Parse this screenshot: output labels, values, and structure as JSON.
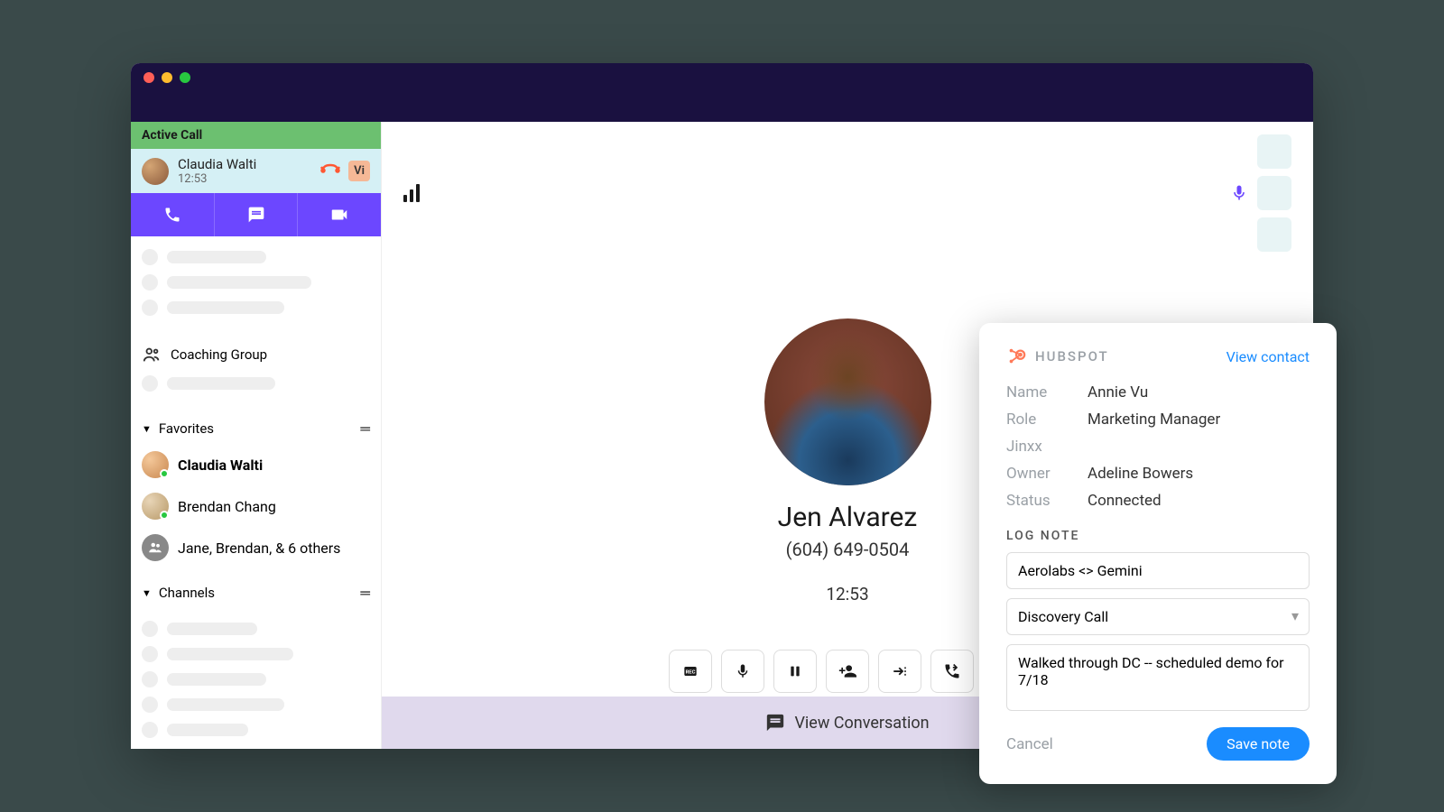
{
  "sidebar": {
    "active_call_label": "Active Call",
    "call": {
      "name": "Claudia Walti",
      "duration": "12:53",
      "badge": "Vi"
    },
    "coaching_label": "Coaching Group",
    "favorites_label": "Favorites",
    "favorites": [
      {
        "name": "Claudia Walti",
        "bold": true
      },
      {
        "name": "Brendan Chang",
        "bold": false
      },
      {
        "name": "Jane, Brendan, & 6 others",
        "group": true
      }
    ],
    "channels_label": "Channels"
  },
  "call_screen": {
    "name": "Jen Alvarez",
    "phone": "(604) 649-0504",
    "timer": "12:53",
    "view_conversation": "View Conversation"
  },
  "crm": {
    "brand": "HUBSPOT",
    "view_contact": "View contact",
    "fields": {
      "name_label": "Name",
      "name_value": "Annie Vu",
      "role_label": "Role",
      "role_value": "Marketing Manager",
      "company": "Jinxx",
      "owner_label": "Owner",
      "owner_value": "Adeline Bowers",
      "status_label": "Status",
      "status_value": "Connected"
    },
    "log_note_label": "LOG NOTE",
    "subject": "Aerolabs <> Gemini",
    "call_type": "Discovery Call",
    "note": "Walked through DC -- scheduled demo for 7/18",
    "cancel": "Cancel",
    "save": "Save note"
  }
}
